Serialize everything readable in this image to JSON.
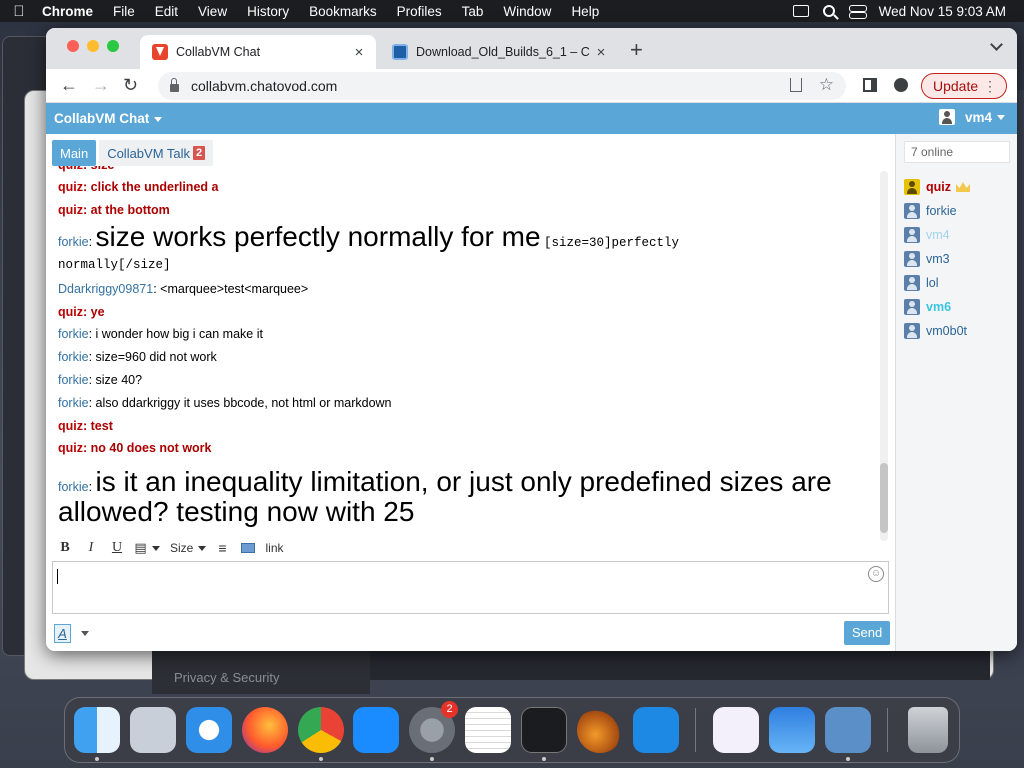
{
  "menubar": {
    "app": "Chrome",
    "items": [
      "File",
      "Edit",
      "View",
      "History",
      "Bookmarks",
      "Profiles",
      "Tab",
      "Window",
      "Help"
    ],
    "clock": "Wed Nov 15  9:03 AM"
  },
  "browser": {
    "tabs": [
      {
        "title": "CollabVM Chat",
        "active": true
      },
      {
        "title": "Download_Old_Builds_6_1 – C",
        "active": false
      }
    ],
    "url": "collabvm.chatovod.com",
    "update_label": "Update"
  },
  "chat": {
    "brand": "CollabVM Chat",
    "current_user": "vm4",
    "tabs": [
      {
        "label": "Main",
        "active": true
      },
      {
        "label": "CollabVM Talk",
        "badge": "2",
        "active": false
      }
    ],
    "messages": [
      {
        "user": "quiz",
        "text": "size",
        "bold": true
      },
      {
        "user": "quiz",
        "text": "click the underlined a",
        "bold": true
      },
      {
        "user": "quiz",
        "text": "at the bottom",
        "bold": true
      },
      {
        "user": "forkie",
        "big": "size works perfectly normally for me",
        "mono1": "[size=30]perfectly",
        "mono2": "normally[/size]"
      },
      {
        "user": "Ddarkriggy09871",
        "text": "<marquee>test<marquee>"
      },
      {
        "user": "quiz",
        "text": "ye",
        "bold": true
      },
      {
        "user": "forkie",
        "text": "i wonder how big i can make it"
      },
      {
        "user": "forkie",
        "text": "size=960 did not work"
      },
      {
        "user": "forkie",
        "text": "size 40?"
      },
      {
        "user": "forkie",
        "text": "also ddarkriggy it uses bbcode, not html or markdown"
      },
      {
        "user": "quiz",
        "text": "test",
        "bold": true
      },
      {
        "user": "quiz",
        "text": "no 40 does not work",
        "bold": true
      },
      {
        "user": "forkie",
        "big": "is it an inequality limitation, or just only predefined sizes are",
        "big2": "allowed? testing now with 25"
      }
    ],
    "online_count": "7 online",
    "users": [
      {
        "name": "quiz",
        "color": "#b00000"
      },
      {
        "name": "forkie",
        "color": "#2a6496"
      },
      {
        "name": "vm4",
        "color": "#9fd4e8"
      },
      {
        "name": "vm3",
        "color": "#2a6496"
      },
      {
        "name": "lol",
        "color": "#2a6496"
      },
      {
        "name": "vm6",
        "color": "#3cc3e0"
      },
      {
        "name": "vm0b0t",
        "color": "#2a6496"
      }
    ],
    "editor": {
      "bold": "B",
      "italic": "I",
      "underline": "U",
      "size": "Size",
      "link": "link",
      "font_button": "A",
      "send": "Send"
    }
  },
  "background": {
    "privacy_label": "Privacy & Security"
  },
  "dock": {
    "apps": [
      "finder-icon",
      "launchpad-icon",
      "safari-icon",
      "firefox-icon",
      "chrome-icon",
      "app-store-icon",
      "system-settings-icon",
      "textedit-icon",
      "terminal-icon",
      "garageband-icon",
      "vscode-icon",
      "visual-studio-icon",
      "weather-icon",
      "virtualbox-icon",
      "trash-icon"
    ],
    "settings_badge": "2"
  }
}
